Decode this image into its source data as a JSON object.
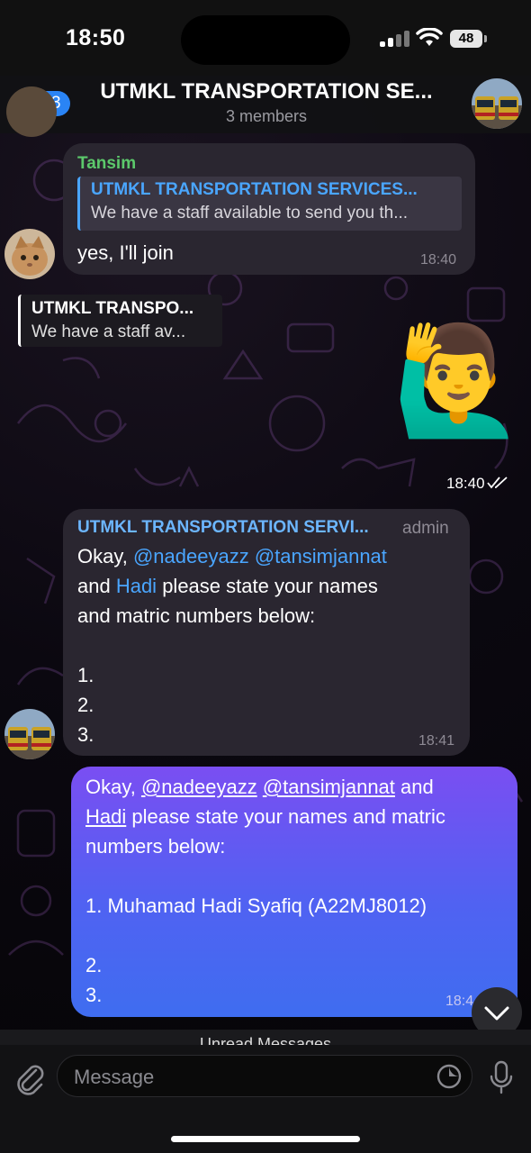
{
  "status": {
    "time": "18:50",
    "battery": "48"
  },
  "header": {
    "back_count": "13",
    "title": "UTMKL TRANSPORTATION SE...",
    "subtitle": "3 members"
  },
  "messages": {
    "m1": {
      "sender": "Tansim",
      "reply_title": "UTMKL TRANSPORTATION SERVICES...",
      "reply_text": "We have a staff available to send you th...",
      "text": "yes, I'll join",
      "time": "18:40"
    },
    "pinned_reply": {
      "title": "UTMKL TRANSPO...",
      "text": "We have a staff av..."
    },
    "m2": {
      "emoji": "🙋‍♂️",
      "time": "18:40"
    },
    "m3": {
      "sender": "UTMKL TRANSPORTATION SERVI...",
      "role": "admin",
      "line1_pre": "Okay, ",
      "mention1": "@nadeeyazz",
      "mention2": "@tansimjannat",
      "line2_pre": "and ",
      "mention3": "Hadi",
      "line2_post": " please state your names",
      "line3": "and matric numbers below:",
      "item1": "1.",
      "item2": "2.",
      "item3": "3.",
      "time": "18:41"
    },
    "m4": {
      "line1_pre": "Okay, ",
      "mention1": "@nadeeyazz",
      "mention2": "@tansimjannat",
      "line1_post": " and",
      "mention3": "Hadi",
      "line2_post": " please state your names and matric",
      "line3": "numbers below:",
      "item1": "1. Muhamad Hadi Syafiq (A22MJ8012)",
      "item2": "2.",
      "item3": "3.",
      "time": "18:4"
    }
  },
  "unread_label": "Unread Messages",
  "input": {
    "placeholder": "Message"
  },
  "colors": {
    "accent": "#4aa6ff",
    "tansim_name": "#5cc96b",
    "admin_name": "#6cb6ff"
  }
}
